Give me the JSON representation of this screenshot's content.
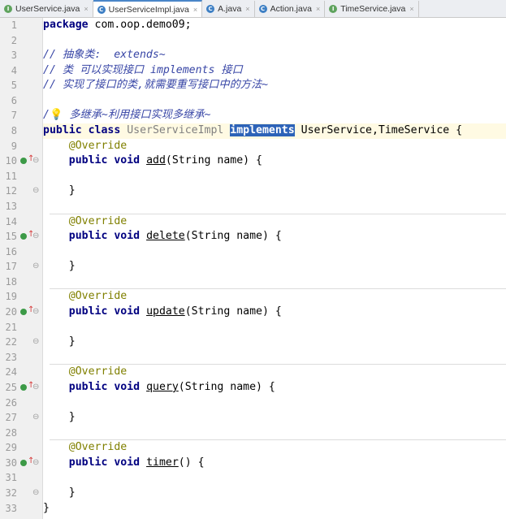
{
  "tabs": [
    {
      "label": "UserService.java",
      "icon": "interface-icon",
      "icon_letter": "I",
      "icon_color": "#5fa35e",
      "active": false
    },
    {
      "label": "UserServiceImpl.java",
      "icon": "class-icon",
      "icon_letter": "C",
      "icon_color": "#3d7fc4",
      "active": true
    },
    {
      "label": "A.java",
      "icon": "class-icon",
      "icon_letter": "C",
      "icon_color": "#3d7fc4",
      "active": false
    },
    {
      "label": "Action.java",
      "icon": "class-icon",
      "icon_letter": "C",
      "icon_color": "#3d7fc4",
      "active": false
    },
    {
      "label": "TimeService.java",
      "icon": "interface-icon",
      "icon_letter": "I",
      "icon_color": "#5fa35e",
      "active": false
    }
  ],
  "tab_close_glyph": "×",
  "fold_glyph": "⊖",
  "impl_arrow_glyph": "↑",
  "current_line": 8,
  "implemented_lines": [
    10,
    15,
    20,
    25,
    30
  ],
  "fold_lines": [
    10,
    12,
    15,
    17,
    20,
    22,
    25,
    27,
    30,
    32
  ],
  "separator_after_lines": [
    13,
    18,
    23,
    28
  ],
  "lines": [
    [
      {
        "t": "package",
        "c": "kw"
      },
      {
        "t": " com.oop.demo09;"
      }
    ],
    [],
    [
      {
        "t": "// 抽象类:  extends~",
        "c": "cm"
      }
    ],
    [
      {
        "t": "// 类 可以实现接口 implements 接口",
        "c": "cm"
      }
    ],
    [
      {
        "t": "// 实现了接口的类,就需要重写接口中的方法~",
        "c": "cm"
      }
    ],
    [],
    [
      {
        "t": "/",
        "c": "cm"
      },
      {
        "t": "💡",
        "c": "bulb"
      },
      {
        "t": " 多继承~利用接口实现多继承~",
        "c": "cm"
      }
    ],
    [
      {
        "t": "public class",
        "c": "kw"
      },
      {
        "t": " "
      },
      {
        "t": "UserServiceImpl",
        "c": "cls-gray"
      },
      {
        "t": " "
      },
      {
        "t": "implements",
        "c": "sel"
      },
      {
        "t": " UserService,TimeService {"
      }
    ],
    [
      {
        "t": "    "
      },
      {
        "t": "@Override",
        "c": "ann"
      }
    ],
    [
      {
        "t": "    "
      },
      {
        "t": "public void",
        "c": "kw"
      },
      {
        "t": " "
      },
      {
        "t": "add",
        "c": "mu"
      },
      {
        "t": "(String name) {"
      }
    ],
    [],
    [
      {
        "t": "    }"
      }
    ],
    [],
    [
      {
        "t": "    "
      },
      {
        "t": "@Override",
        "c": "ann"
      }
    ],
    [
      {
        "t": "    "
      },
      {
        "t": "public void",
        "c": "kw"
      },
      {
        "t": " "
      },
      {
        "t": "delete",
        "c": "mu"
      },
      {
        "t": "(String name) {"
      }
    ],
    [],
    [
      {
        "t": "    }"
      }
    ],
    [],
    [
      {
        "t": "    "
      },
      {
        "t": "@Override",
        "c": "ann"
      }
    ],
    [
      {
        "t": "    "
      },
      {
        "t": "public void",
        "c": "kw"
      },
      {
        "t": " "
      },
      {
        "t": "update",
        "c": "mu"
      },
      {
        "t": "(String name) {"
      }
    ],
    [],
    [
      {
        "t": "    }"
      }
    ],
    [],
    [
      {
        "t": "    "
      },
      {
        "t": "@Override",
        "c": "ann"
      }
    ],
    [
      {
        "t": "    "
      },
      {
        "t": "public void",
        "c": "kw"
      },
      {
        "t": " "
      },
      {
        "t": "query",
        "c": "mu"
      },
      {
        "t": "(String name) {"
      }
    ],
    [],
    [
      {
        "t": "    }"
      }
    ],
    [],
    [
      {
        "t": "    "
      },
      {
        "t": "@Override",
        "c": "ann"
      }
    ],
    [
      {
        "t": "    "
      },
      {
        "t": "public void",
        "c": "kw"
      },
      {
        "t": " "
      },
      {
        "t": "timer",
        "c": "mu"
      },
      {
        "t": "() {"
      }
    ],
    [],
    [
      {
        "t": "    }"
      }
    ],
    [
      {
        "t": "}"
      }
    ]
  ]
}
